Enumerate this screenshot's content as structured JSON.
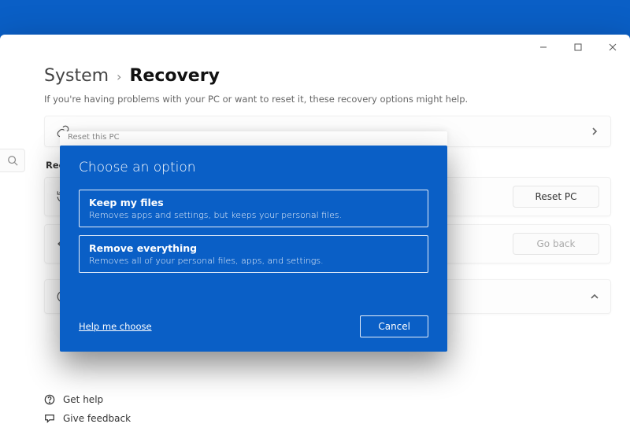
{
  "breadcrumb": {
    "parent": "System",
    "sep": "›",
    "current": "Recovery"
  },
  "subtitle": "If you're having problems with your PC or want to reset it, these recovery options might help.",
  "cards": {
    "reset_pc": {
      "label": "Reset this PC",
      "button": "Reset PC",
      "go_back": "Go back"
    }
  },
  "section_label": "Reco",
  "links": {
    "get_help": "Get help",
    "give_feedback": "Give feedback"
  },
  "modal": {
    "strip": "Reset this PC",
    "title": "Choose an option",
    "options": [
      {
        "title": "Keep my files",
        "desc": "Removes apps and settings, but keeps your personal files."
      },
      {
        "title": "Remove everything",
        "desc": "Removes all of your personal files, apps, and settings."
      }
    ],
    "help": "Help me choose",
    "cancel": "Cancel"
  },
  "win": {
    "min": "–",
    "max": "▢",
    "close": "✕"
  }
}
